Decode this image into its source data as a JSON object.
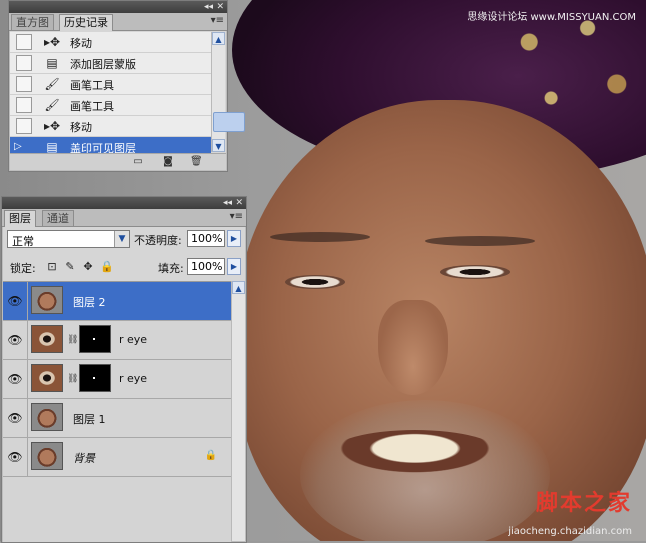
{
  "watermarks": {
    "top": "思缘设计论坛 www.MISSYUAN.COM",
    "logo": "脚本之家",
    "url": "jiaocheng.chazidian.com"
  },
  "history_panel": {
    "tabs": [
      "直方图",
      "历史记录"
    ],
    "active_tab": "历史记录",
    "items": [
      {
        "label": "移动",
        "icon": "move-tool-icon"
      },
      {
        "label": "添加图层蒙版",
        "icon": "layer-mask-icon"
      },
      {
        "label": "画笔工具",
        "icon": "brush-tool-icon"
      },
      {
        "label": "画笔工具",
        "icon": "brush-tool-icon"
      },
      {
        "label": "移动",
        "icon": "move-tool-icon"
      },
      {
        "label": "盖印可见图层",
        "icon": "stamp-visible-icon",
        "selected": true
      }
    ],
    "footer_icons": [
      "new-document-from-state-icon",
      "create-snapshot-icon",
      "delete-state-icon"
    ]
  },
  "layers_panel": {
    "tabs": [
      "图层",
      "通道"
    ],
    "active_tab": "图层",
    "blend_mode": "正常",
    "opacity_label": "不透明度:",
    "opacity_value": "100%",
    "lock_label": "锁定:",
    "fill_label": "填充:",
    "fill_value": "100%",
    "layers": [
      {
        "name": "图层 2",
        "selected": true,
        "thumb": "face",
        "visible": true
      },
      {
        "name": "r eye",
        "thumb": "eye",
        "mask": true,
        "visible": true
      },
      {
        "name": "r eye",
        "thumb": "eye",
        "mask": true,
        "visible": true
      },
      {
        "name": "图层 1",
        "thumb": "face",
        "visible": true
      },
      {
        "name": "背景",
        "thumb": "face",
        "locked": true,
        "visible": true
      }
    ]
  },
  "colors": {
    "selection": "#3d6ec7",
    "panel_bg": "#d6d6d6",
    "titlebar": "#3d3d3d",
    "watermark_logo": "#e23b2e"
  }
}
